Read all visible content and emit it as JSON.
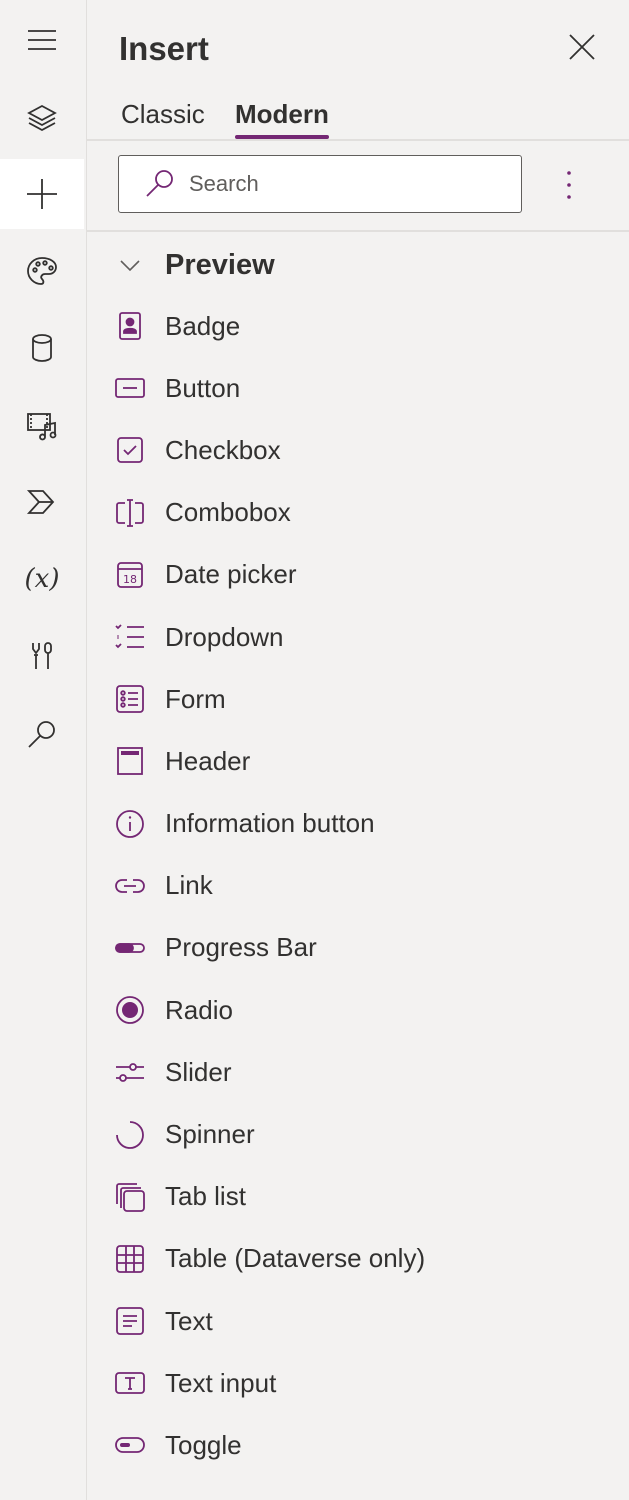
{
  "rail": {
    "items": [
      {
        "name": "menu-icon"
      },
      {
        "name": "layers-icon"
      },
      {
        "name": "add-icon",
        "active": true
      },
      {
        "name": "palette-icon"
      },
      {
        "name": "database-icon"
      },
      {
        "name": "media-icon"
      },
      {
        "name": "power-automate-icon"
      },
      {
        "name": "variables-icon",
        "text": "(x)"
      },
      {
        "name": "tools-icon"
      },
      {
        "name": "search-icon"
      }
    ]
  },
  "panel": {
    "title": "Insert",
    "tabs": [
      "Classic",
      "Modern"
    ],
    "active_tab": "Modern",
    "search_placeholder": "Search"
  },
  "section": {
    "label": "Preview",
    "items": [
      {
        "label": "Badge",
        "icon": "badge-icon"
      },
      {
        "label": "Button",
        "icon": "button-icon"
      },
      {
        "label": "Checkbox",
        "icon": "checkbox-icon"
      },
      {
        "label": "Combobox",
        "icon": "combobox-icon"
      },
      {
        "label": "Date picker",
        "icon": "calendar-icon"
      },
      {
        "label": "Dropdown",
        "icon": "dropdown-list-icon"
      },
      {
        "label": "Form",
        "icon": "form-icon"
      },
      {
        "label": "Header",
        "icon": "header-icon"
      },
      {
        "label": "Information button",
        "icon": "info-icon"
      },
      {
        "label": "Link",
        "icon": "link-icon"
      },
      {
        "label": "Progress Bar",
        "icon": "progress-bar-icon"
      },
      {
        "label": "Radio",
        "icon": "radio-icon"
      },
      {
        "label": "Slider",
        "icon": "slider-icon"
      },
      {
        "label": "Spinner",
        "icon": "spinner-icon"
      },
      {
        "label": "Tab list",
        "icon": "tab-list-icon"
      },
      {
        "label": "Table (Dataverse only)",
        "icon": "table-icon"
      },
      {
        "label": "Text",
        "icon": "text-icon"
      },
      {
        "label": "Text input",
        "icon": "text-input-icon"
      },
      {
        "label": "Toggle",
        "icon": "toggle-icon"
      }
    ]
  },
  "colors": {
    "accent": "#742774",
    "background": "#f3f2f1",
    "text": "#323130"
  }
}
